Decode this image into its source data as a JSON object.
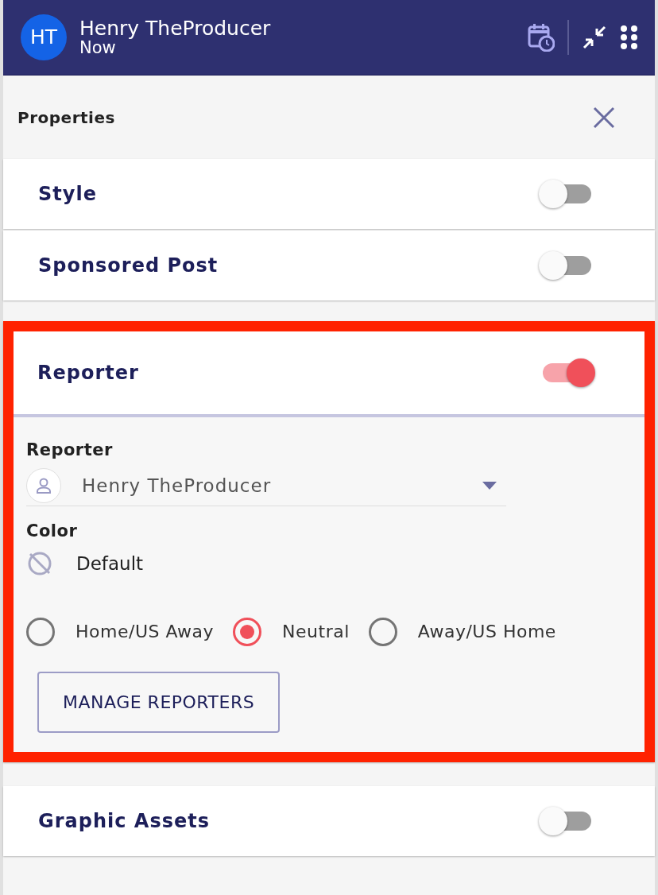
{
  "header": {
    "avatar": "HT",
    "name": "Henry TheProducer",
    "time": "Now"
  },
  "panel": {
    "title": "Properties"
  },
  "sections": [
    {
      "title": "Style",
      "on": false
    },
    {
      "title": "Sponsored Post",
      "on": false
    },
    {
      "title": "Reporter",
      "on": true,
      "highlighted": true,
      "reporter_label": "Reporter",
      "reporter_value": "Henry TheProducer",
      "color_label": "Color",
      "color_value": "Default",
      "options": [
        {
          "label": "Home/US Away",
          "selected": false
        },
        {
          "label": "Neutral",
          "selected": true
        },
        {
          "label": "Away/US Home",
          "selected": false
        }
      ],
      "button": "MANAGE REPORTERS"
    },
    {
      "title": "Graphic Assets",
      "on": false
    }
  ]
}
